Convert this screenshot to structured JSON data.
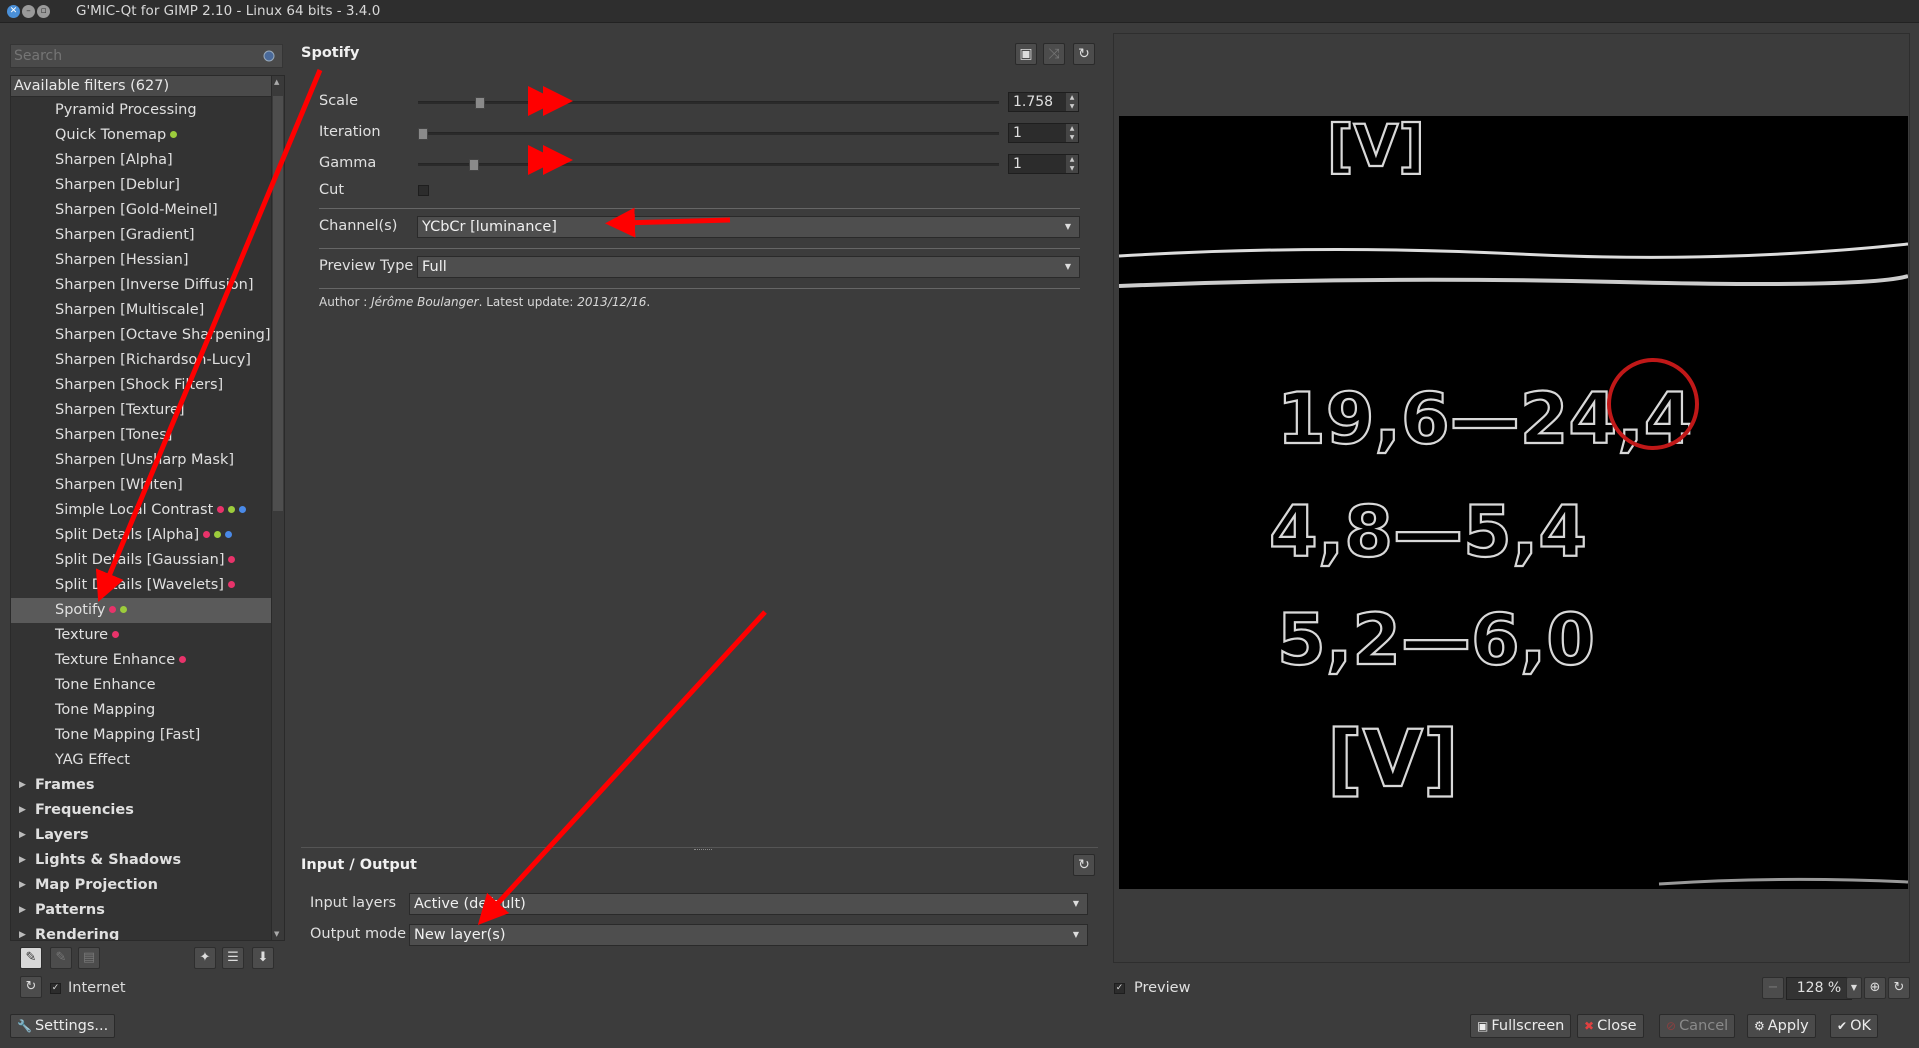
{
  "window": {
    "title": "G'MIC-Qt for GIMP 2.10 - Linux 64 bits - 3.4.0"
  },
  "search": {
    "placeholder": "Search"
  },
  "filters": {
    "header": "Available filters (627)",
    "items": [
      {
        "label": "Pyramid Processing",
        "dots": []
      },
      {
        "label": "Quick Tonemap",
        "dots": [
          "#9ccc3c"
        ]
      },
      {
        "label": "Sharpen [Alpha]",
        "dots": []
      },
      {
        "label": "Sharpen [Deblur]",
        "dots": []
      },
      {
        "label": "Sharpen [Gold-Meinel]",
        "dots": []
      },
      {
        "label": "Sharpen [Gradient]",
        "dots": []
      },
      {
        "label": "Sharpen [Hessian]",
        "dots": []
      },
      {
        "label": "Sharpen [Inverse Diffusion]",
        "dots": []
      },
      {
        "label": "Sharpen [Multiscale]",
        "dots": []
      },
      {
        "label": "Sharpen [Octave Sharpening]",
        "dots": []
      },
      {
        "label": "Sharpen [Richardson-Lucy]",
        "dots": []
      },
      {
        "label": "Sharpen [Shock Filters]",
        "dots": []
      },
      {
        "label": "Sharpen [Texture]",
        "dots": []
      },
      {
        "label": "Sharpen [Tones]",
        "dots": []
      },
      {
        "label": "Sharpen [Unsharp Mask]",
        "dots": []
      },
      {
        "label": "Sharpen [Whiten]",
        "dots": []
      },
      {
        "label": "Simple Local Contrast",
        "dots": [
          "#e8336a",
          "#9ccc3c",
          "#4a8ae8"
        ]
      },
      {
        "label": "Split Details [Alpha]",
        "dots": [
          "#e8336a",
          "#9ccc3c",
          "#4a8ae8"
        ]
      },
      {
        "label": "Split Details [Gaussian]",
        "dots": [
          "#e8336a"
        ]
      },
      {
        "label": "Split Details [Wavelets]",
        "dots": [
          "#e8336a"
        ]
      },
      {
        "label": "Spotify",
        "dots": [
          "#e8336a",
          "#9ccc3c"
        ],
        "selected": true
      },
      {
        "label": "Texture",
        "dots": [
          "#e8336a"
        ]
      },
      {
        "label": "Texture Enhance",
        "dots": [
          "#e8336a"
        ]
      },
      {
        "label": "Tone Enhance",
        "dots": []
      },
      {
        "label": "Tone Mapping",
        "dots": []
      },
      {
        "label": "Tone Mapping [Fast]",
        "dots": []
      },
      {
        "label": "YAG Effect",
        "dots": []
      }
    ],
    "groups": [
      "Frames",
      "Frequencies",
      "Layers",
      "Lights & Shadows",
      "Map Projection",
      "Patterns",
      "Rendering"
    ]
  },
  "internet": {
    "label": "Internet",
    "checked": true
  },
  "settings_button": "Settings...",
  "filter": {
    "title": "Spotify",
    "params": {
      "scale": {
        "label": "Scale",
        "value": "1.758",
        "fraction": 0.1
      },
      "iteration": {
        "label": "Iteration",
        "value": "1",
        "fraction": 0.0
      },
      "gamma": {
        "label": "Gamma",
        "value": "1",
        "fraction": 0.09
      },
      "cut": {
        "label": "Cut",
        "checked": false
      },
      "channels": {
        "label": "Channel(s)",
        "value": "YCbCr [luminance]"
      },
      "preview_type": {
        "label": "Preview Type",
        "value": "Full"
      }
    },
    "author_prefix": "Author : ",
    "author_name": "Jérôme Boulanger",
    "author_mid": ". Latest update: ",
    "author_date": "2013/12/16",
    "author_suffix": "."
  },
  "io": {
    "title": "Input / Output",
    "input_label": "Input layers",
    "input_value": "Active (default)",
    "output_label": "Output mode",
    "output_value": "New layer(s)"
  },
  "preview": {
    "label": "Preview",
    "checked": true,
    "zoom": "128 %",
    "image_lines": [
      "19,6—24,4",
      "4,8—5,4",
      "5,2—6,0",
      "[V]",
      "[V]"
    ]
  },
  "buttons": {
    "fullscreen": "Fullscreen",
    "close": "Close",
    "cancel": "Cancel",
    "apply": "Apply",
    "ok": "OK"
  },
  "colors": {
    "annotation": "#ff0000",
    "selected_row": "#5a5a5a",
    "background": "#3c3c3c"
  }
}
